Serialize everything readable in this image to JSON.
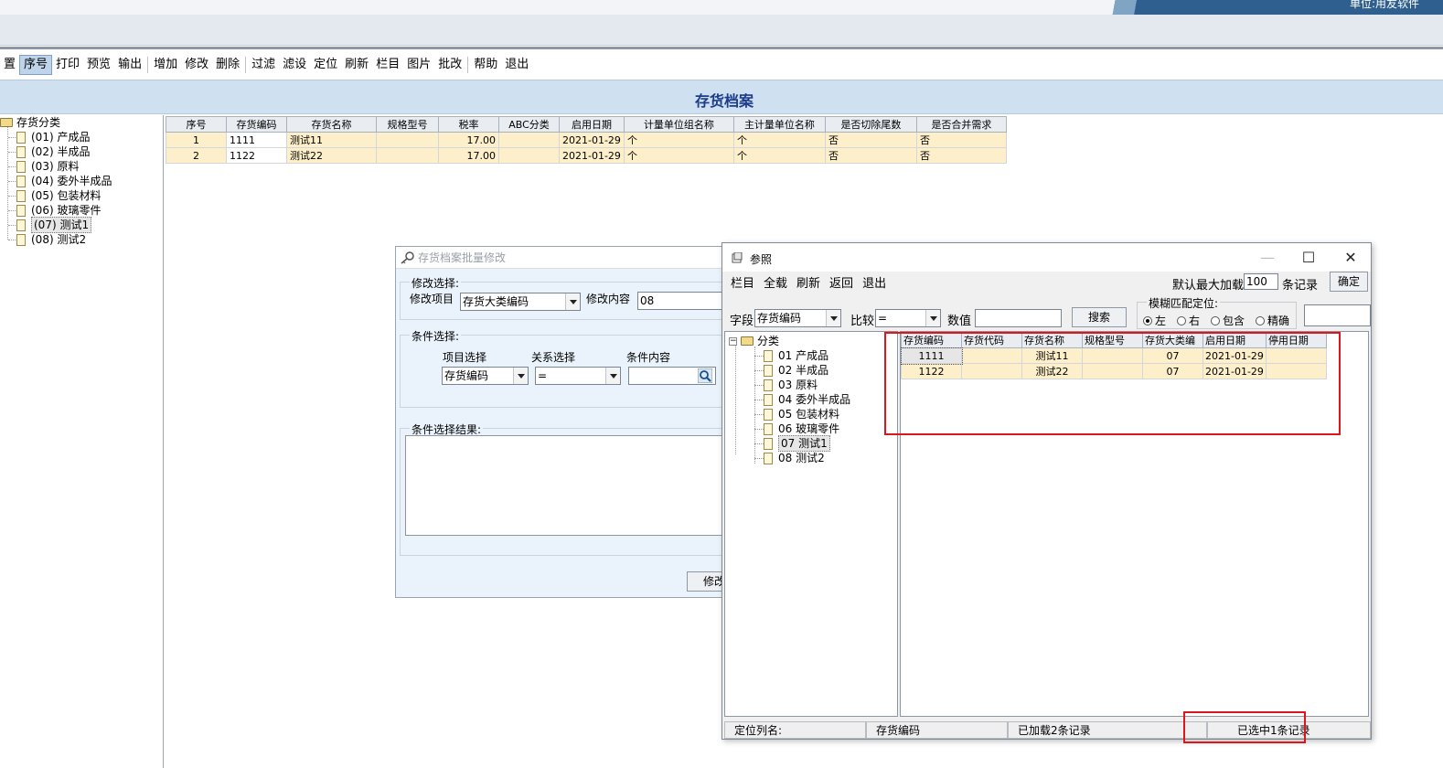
{
  "header": {
    "corp_text": "单位:用友软件"
  },
  "toolbar": {
    "items": [
      "置",
      "序号",
      "打印",
      "预览",
      "输出",
      "增加",
      "修改",
      "删除",
      "过滤",
      "滤设",
      "定位",
      "刷新",
      "栏目",
      "图片",
      "批改",
      "帮助",
      "退出"
    ],
    "active": "序号"
  },
  "page_title": "存货档案",
  "left_tree": {
    "root": "存货分类",
    "items": [
      "(01) 产成品",
      "(02) 半成品",
      "(03) 原料",
      "(04) 委外半成品",
      "(05) 包装材料",
      "(06) 玻璃零件",
      "(07) 测试1",
      "(08) 测试2"
    ],
    "selected": "(07) 测试1"
  },
  "main_grid": {
    "columns": [
      "序号",
      "存货编码",
      "存货名称",
      "规格型号",
      "税率",
      "ABC分类",
      "启用日期",
      "计量单位组名称",
      "主计量单位名称",
      "是否切除尾数",
      "是否合并需求"
    ],
    "rows": [
      [
        "1",
        "1111",
        "测试11",
        "",
        "17.00",
        "",
        "2021-01-29",
        "个",
        "个",
        "否",
        "否"
      ],
      [
        "2",
        "1122",
        "测试22",
        "",
        "17.00",
        "",
        "2021-01-29",
        "个",
        "个",
        "否",
        "否"
      ]
    ]
  },
  "batch_dialog": {
    "title": "存货档案批量修改",
    "modify_group": "修改选择:",
    "modify_item_label": "修改项目",
    "modify_item_value": "存货大类编码",
    "modify_content_label": "修改内容",
    "modify_content_value": "08",
    "cond_group": "条件选择:",
    "item_select_label": "项目选择",
    "relation_label": "关系选择",
    "cond_content_label": "条件内容",
    "item_select_value": "存货编码",
    "relation_value": "=",
    "cond_content_value": "",
    "result_group": "条件选择结果:",
    "modify_button": "修改"
  },
  "ref_dialog": {
    "title": "参照",
    "toolbar": [
      "栏目",
      "全载",
      "刷新",
      "返回",
      "退出"
    ],
    "max_load_label": "默认最大加载",
    "max_load_value": "100",
    "records_label": "条记录",
    "ok_button": "确定",
    "field_label": "字段",
    "field_value": "存货编码",
    "compare_label": "比较",
    "compare_value": "=",
    "value_label": "数值",
    "value_input": "",
    "search_button": "搜索",
    "fuzzy_label": "模糊匹配定位:",
    "fuzzy_options": [
      "左",
      "右",
      "包含",
      "精确"
    ],
    "fuzzy_selected": "左",
    "tree": {
      "root": "分类",
      "items": [
        "01 产成品",
        "02 半成品",
        "03 原料",
        "04 委外半成品",
        "05 包装材料",
        "06 玻璃零件",
        "07 测试1",
        "08 测试2"
      ],
      "selected": "07 测试1"
    },
    "grid": {
      "columns": [
        "存货编码",
        "存货代码",
        "存货名称",
        "规格型号",
        "存货大类编",
        "启用日期",
        "停用日期"
      ],
      "rows": [
        [
          "1111",
          "",
          "测试11",
          "",
          "07",
          "2021-01-29",
          ""
        ],
        [
          "1122",
          "",
          "测试22",
          "",
          "07",
          "2021-01-29",
          ""
        ]
      ]
    },
    "status": {
      "locate_label": "定位列名:",
      "locate_value": "存货编码",
      "loaded": "已加载2条记录",
      "selected": "已选中1条记录"
    }
  },
  "colors": {
    "title_text": "#1b3d8c",
    "row_highlight": "#fdefc9",
    "annotation_red": "#e0141c",
    "title_band": "#cfe0f1"
  }
}
